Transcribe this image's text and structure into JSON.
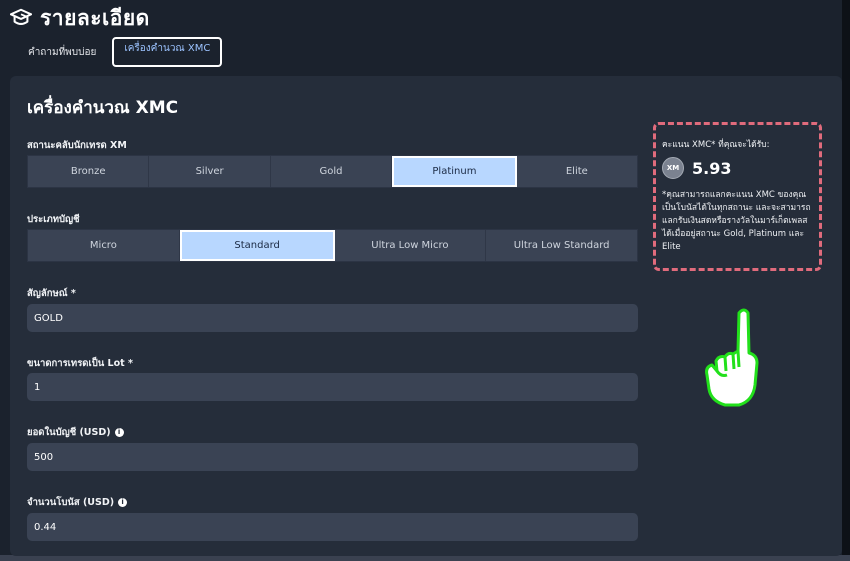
{
  "header": {
    "title": "รายละเอียด"
  },
  "tabs": [
    {
      "label": "คำถามที่พบบ่อย"
    },
    {
      "label": "เครื่องคำนวณ XMC"
    }
  ],
  "calculator": {
    "title": "เครื่องคำนวณ XMC",
    "status": {
      "label": "สถานะคลับนักเทรด XM",
      "options": [
        "Bronze",
        "Silver",
        "Gold",
        "Platinum",
        "Elite"
      ],
      "selected": "Platinum"
    },
    "account": {
      "label": "ประเภทบัญชี",
      "options": [
        "Micro",
        "Standard",
        "Ultra Low Micro",
        "Ultra Low Standard"
      ],
      "selected": "Standard"
    },
    "symbol": {
      "label": "สัญลักษณ์ *",
      "value": "GOLD"
    },
    "lot": {
      "label": "ขนาดการเทรดเป็น Lot *",
      "value": "1"
    },
    "balance": {
      "label": "ยอดในบัญชี (USD)",
      "value": "500"
    },
    "bonus": {
      "label": "จำนวนโบนัส (USD)",
      "value": "0.44"
    }
  },
  "result": {
    "label": "คะแนน XMC* ที่คุณจะได้รับ:",
    "coin_text": "XM",
    "value": "5.93",
    "note": "*คุณสามารถแลกคะแนน XMC ของคุณเป็นโบนัสได้ในทุกสถานะ และจะสามารถแลกรับเงินสดหรือรางวัลในมาร์เก็ตเพลสได้เมื่ออยู่สถานะ Gold, Platinum และ Elite"
  },
  "colors": {
    "selected_bg": "#b8d7ff",
    "highlight_border": "#e06b7c",
    "hand_outline": "#22e01b"
  }
}
